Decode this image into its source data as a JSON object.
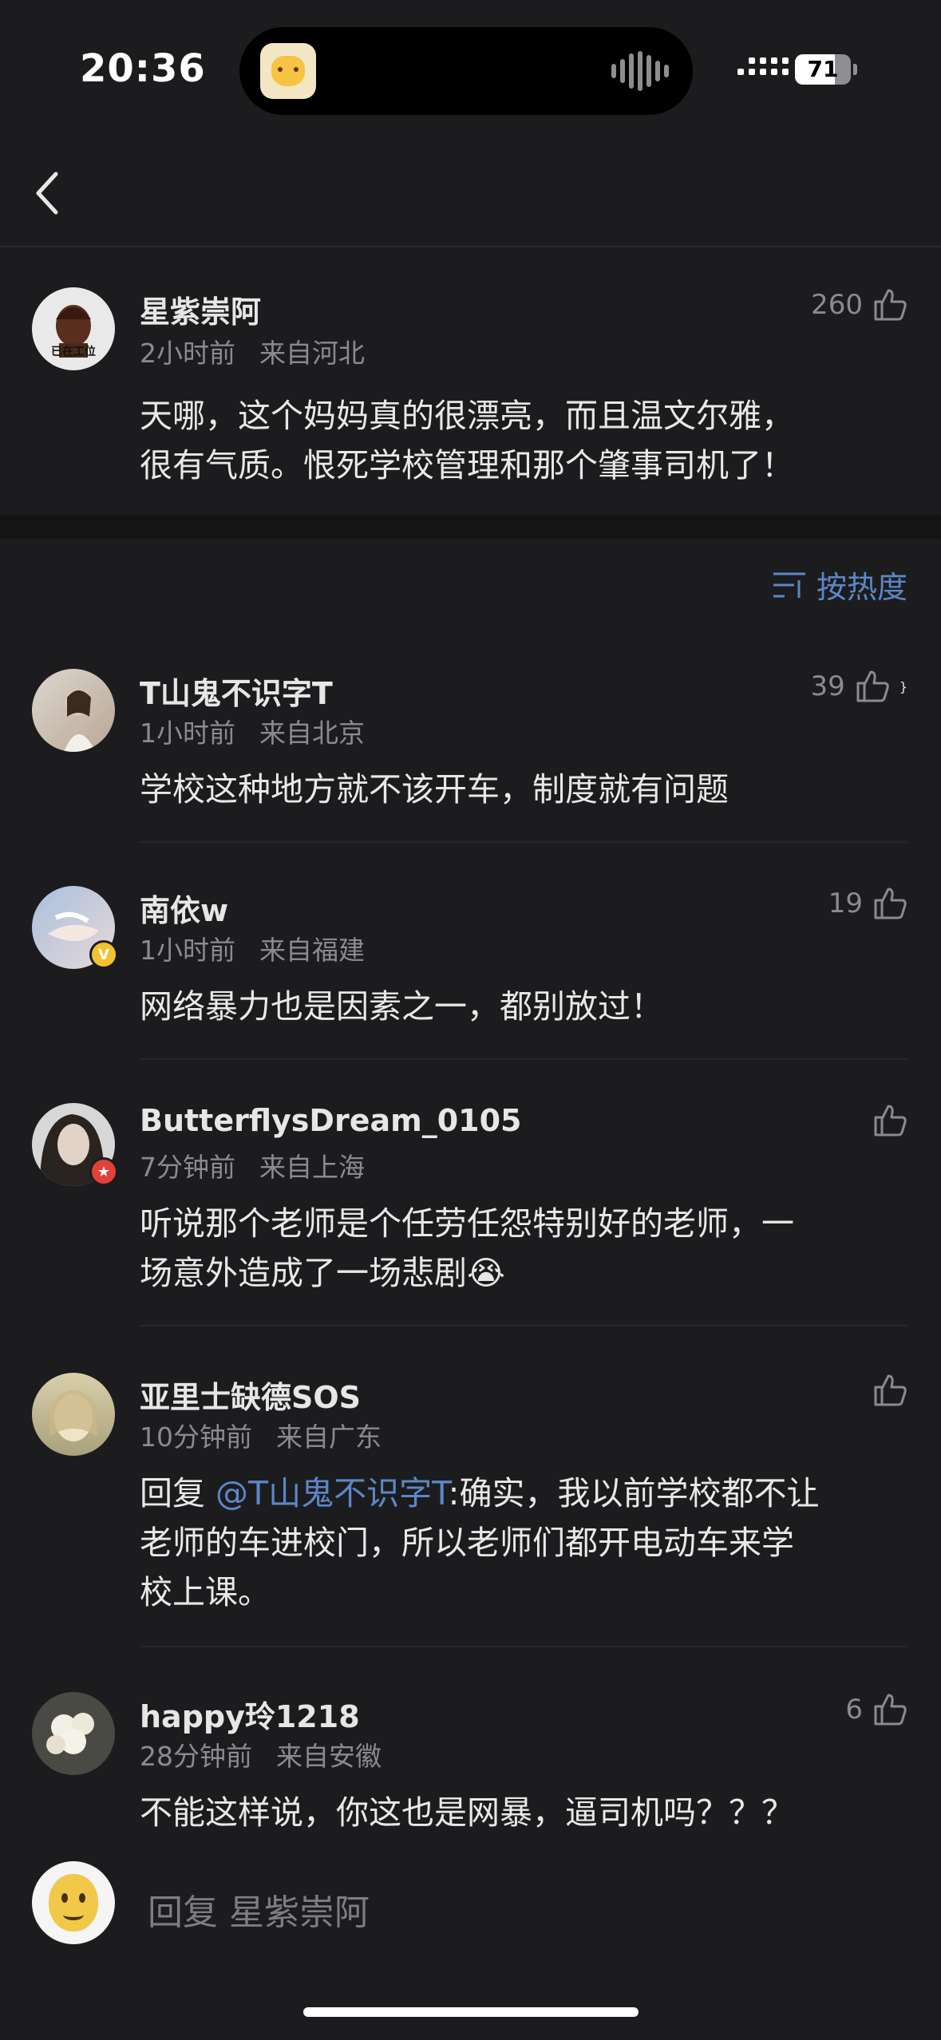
{
  "status_bar": {
    "time": "20:36",
    "battery": "71",
    "battery_level": 0.71
  },
  "parent_comment": {
    "username": "星紫崇阿",
    "time": "2小时前",
    "location": "来自河北",
    "likes": "260",
    "avatar_text": "已在工位",
    "text_line1": "天哪，这个妈妈真的很漂亮，而且温文尔雅，",
    "text_line2": "很有气质。恨死学校管理和那个肇事司机了！"
  },
  "sort": {
    "label": "按热度"
  },
  "replies": [
    {
      "username": "T山鬼不识字T",
      "time": "1小时前",
      "location": "来自北京",
      "likes": "39",
      "lines": [
        "学校这种地方就不该开车，制度就有问题"
      ]
    },
    {
      "username": "南依w",
      "time": "1小时前",
      "location": "来自福建",
      "likes": "19",
      "lines": [
        "网络暴力也是因素之一，都别放过！"
      ]
    },
    {
      "username": "ButterflysDream_0105",
      "time": "7分钟前",
      "location": "来自上海",
      "likes": "",
      "lines": [
        "听说那个老师是个任劳任怨特别好的老师，一",
        "场意外造成了一场悲剧😭"
      ]
    },
    {
      "username": "亚里士缺德SOS",
      "time": "10分钟前",
      "location": "来自广东",
      "likes": "",
      "reply_prefix": "回复 ",
      "mention": "@T山鬼不识字T",
      "line1_rest": ":确实，我以前学校都不让",
      "lines": [
        "老师的车进校门，所以老师们都开电动车来学",
        "校上课。"
      ]
    },
    {
      "username": "happy玲1218",
      "time": "28分钟前",
      "location": "来自安徽",
      "likes": "6",
      "lines": [
        "不能这样说，你这也是网暴，逼司机吗？？？"
      ]
    }
  ],
  "reply_bar": {
    "placeholder": "回复 星紫崇阿"
  },
  "icons": {
    "back": "chevron-left-icon",
    "like": "thumbs-up-icon",
    "sort": "sort-icon"
  },
  "colors": {
    "background": "#1c1c1e",
    "accent": "#5b87c7"
  }
}
